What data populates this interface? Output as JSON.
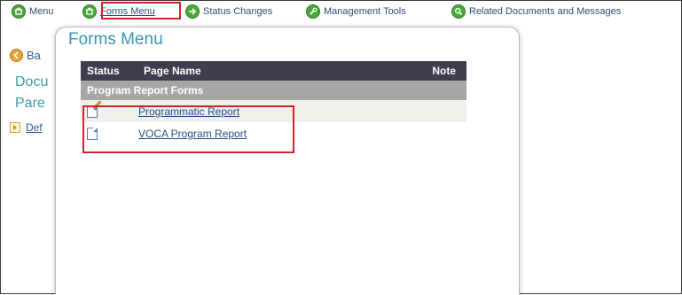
{
  "topnav": {
    "items": [
      {
        "label": "Menu",
        "icon": "home-icon",
        "underlined": false
      },
      {
        "label": "Forms Menu",
        "icon": "forms-icon",
        "underlined": true
      },
      {
        "label": "Status Changes",
        "icon": "arrow-right-icon",
        "underlined": false
      },
      {
        "label": "Management Tools",
        "icon": "wrench-icon",
        "underlined": false
      },
      {
        "label": "Related Documents and Messages",
        "icon": "search-icon",
        "underlined": false
      }
    ]
  },
  "background": {
    "back_label": "Ba",
    "heading_line1": "Docu",
    "heading_line2": "Pare",
    "link_label": "Def"
  },
  "modal": {
    "title": "Forms Menu",
    "table": {
      "columns": [
        "Status",
        "Page Name",
        "Note"
      ],
      "group": "Program Report Forms",
      "rows": [
        {
          "icon": "edit-document-icon",
          "page_name": "Programmatic Report",
          "note": ""
        },
        {
          "icon": "document-icon",
          "page_name": "VOCA Program Report",
          "note": ""
        }
      ]
    }
  },
  "colors": {
    "nav_icon_green": "#4aa83a",
    "table_header": "#3f3e4f",
    "group_header": "#a6a6a6",
    "highlight": "#d0232c",
    "title_teal": "#3a97b3"
  }
}
